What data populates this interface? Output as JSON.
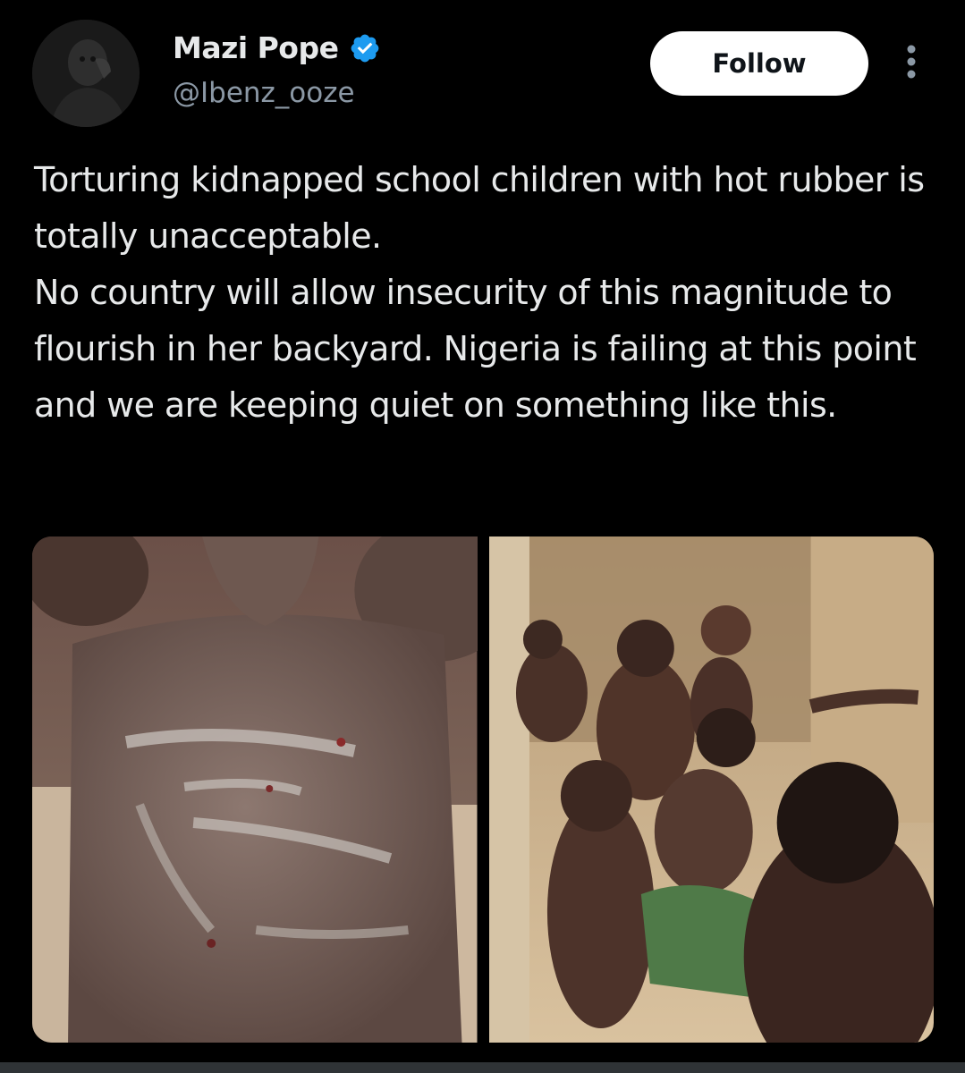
{
  "post": {
    "author": {
      "display_name": "Mazi Pope",
      "handle": "@Ibenz_ooze",
      "verified_icon": "verified-badge-icon",
      "verified_color": "#1d9bf0"
    },
    "actions": {
      "follow_label": "Follow",
      "more_icon": "more-vertical-icon"
    },
    "text": {
      "line1": "Torturing kidnapped school children with hot rubber is totally unacceptable.",
      "line2": "No country will allow insecurity of this magnitude to flourish in her backyard. Nigeria is failing at this point and we are keeping quiet on something like this."
    },
    "media": [
      {
        "kind": "photo"
      },
      {
        "kind": "photo"
      }
    ]
  },
  "colors": {
    "background": "#000000",
    "text_primary": "#e7e9ea",
    "text_secondary": "#8b98a5",
    "follow_bg": "#ffffff",
    "follow_text": "#0f1419"
  }
}
